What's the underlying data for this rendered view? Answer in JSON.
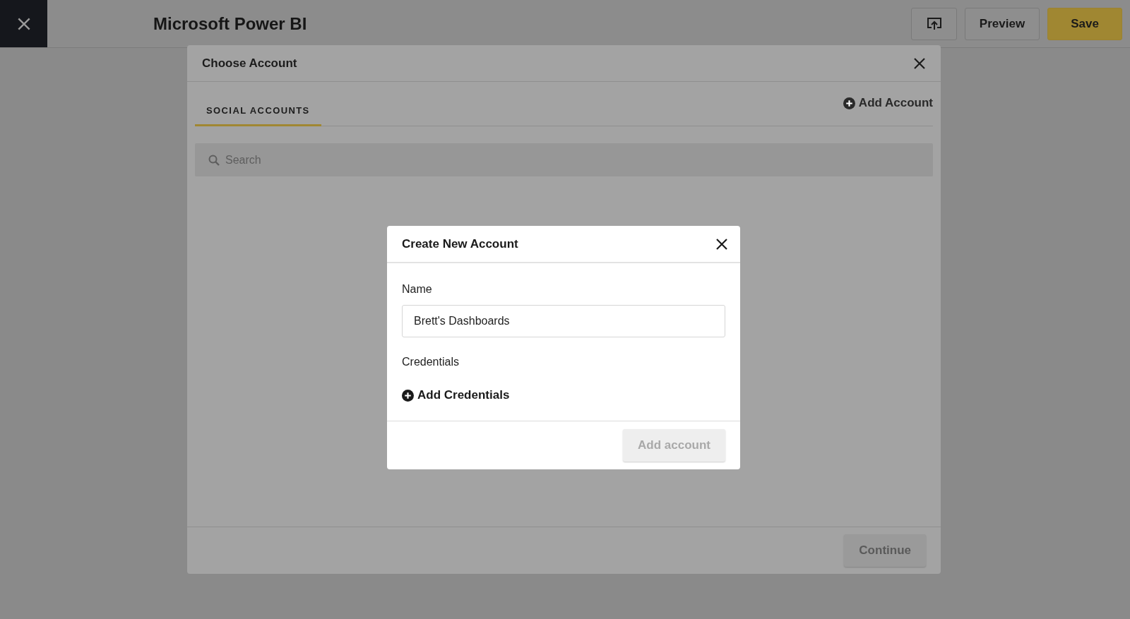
{
  "top_bar": {
    "title": "Microsoft Power BI",
    "buttons": [
      {
        "kind": "icon"
      },
      {
        "kind": "text",
        "label": "Preview"
      },
      {
        "kind": "primary",
        "label": "Save"
      }
    ]
  },
  "choose_account": {
    "title": "Choose Account",
    "tabs": [
      {
        "label": "SOCIAL ACCOUNTS",
        "selected": true
      }
    ],
    "add_account": "Add Account",
    "search": {
      "placeholder": "Search"
    },
    "continue": {
      "label": "Continue",
      "disabled": true
    }
  },
  "create_account": {
    "title": "Create New Account",
    "name_label": "Name",
    "name_value": "Brett's Dashboards",
    "credentials_label": "Credentials",
    "add_credentials": "Add Credentials",
    "submit": {
      "label": "Add account",
      "disabled": true
    }
  }
}
